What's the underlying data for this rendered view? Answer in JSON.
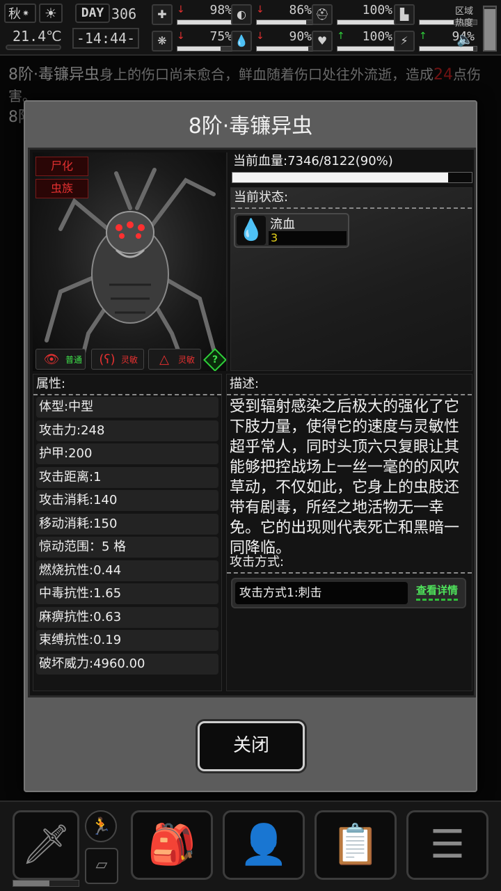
{
  "status_bar": {
    "season": "秋",
    "day_label": "DAY",
    "day": "306",
    "temperature": "21.4℃",
    "time": "-14:44-",
    "region_heat_label": "区域热度",
    "region_heat_level": 0.95,
    "stats": [
      {
        "name": "health",
        "icon": "medkit-icon",
        "value": "98%",
        "arrow": "down",
        "fill": 0.98
      },
      {
        "name": "hunger",
        "icon": "stomach-icon",
        "value": "86%",
        "arrow": "down",
        "fill": 0.86
      },
      {
        "name": "armor",
        "icon": "helmet-icon",
        "value": "100%",
        "arrow": "",
        "fill": 1.0
      },
      {
        "name": "stamina",
        "icon": "boot-icon",
        "value": "",
        "arrow": "",
        "fill": 0.6
      },
      {
        "name": "sanity",
        "icon": "brain-icon",
        "value": "75%",
        "arrow": "down",
        "fill": 0.75
      },
      {
        "name": "thirst",
        "icon": "water-drop-icon",
        "value": "90%",
        "arrow": "down",
        "fill": 0.9
      },
      {
        "name": "mood",
        "icon": "heart-icon",
        "value": "100%",
        "arrow": "up",
        "fill": 1.0
      },
      {
        "name": "energy",
        "icon": "bolt-icon",
        "value": "94%",
        "arrow": "up",
        "fill": 0.94
      }
    ]
  },
  "log": {
    "line1_enemy": "8阶·毒镰异虫",
    "line1_text": "身上的伤口尚未愈合，鲜血随着伤口处往外流逝，造成",
    "line1_damage": "24",
    "line1_tail": "点伤害。",
    "line2_enemy": "8阶·毒镰异虫"
  },
  "modal": {
    "title": "8阶·毒镰异虫",
    "tags": [
      "尸化",
      "虫族"
    ],
    "senses": [
      {
        "icon": "eye-icon",
        "label": "普通"
      },
      {
        "icon": "ear-icon",
        "label": "灵敏"
      },
      {
        "icon": "nose-icon",
        "label": "灵敏"
      }
    ],
    "help_icon": "?",
    "hp_text": "当前血量:7346/8122(90%)",
    "hp_fraction": 0.9,
    "status_label": "当前状态:",
    "effects": [
      {
        "icon": "blood-drop-icon",
        "name": "流血",
        "stacks": "3"
      }
    ],
    "attributes_label": "属性:",
    "attributes": [
      "体型:中型",
      "攻击力:248",
      "护甲:200",
      "攻击距离:1",
      "攻击消耗:140",
      "移动消耗:150",
      "惊动范围：5 格",
      "燃烧抗性:0.44",
      "中毒抗性:1.65",
      "麻痹抗性:0.63",
      "束缚抗性:0.19",
      "破坏威力:4960.00"
    ],
    "description_label": "描述:",
    "description": "受到辐射感染之后极大的强化了它下肢力量，使得它的速度与灵敏性超乎常人，同时头顶六只复眼让其能够把控战场上一丝一毫的的风吹草动，不仅如此，它身上的虫肢还带有剧毒，所经之地活物无一幸免。它的出现则代表死亡和黑暗一同降临。",
    "attack_label": "攻击方式:",
    "attacks": [
      {
        "name": "攻击方式1:刺击",
        "detail_label": "查看详情"
      }
    ],
    "close_label": "关闭"
  },
  "toolbar": {
    "weapon_icon": "knife-icon",
    "run_icon": "running-man-icon",
    "backpack_icon": "backpack-icon",
    "skills_icon": "head-brain-icon",
    "notes_icon": "notebook-icon",
    "menu_icon": "menu-list-icon",
    "weapon_durability": 0.55
  }
}
